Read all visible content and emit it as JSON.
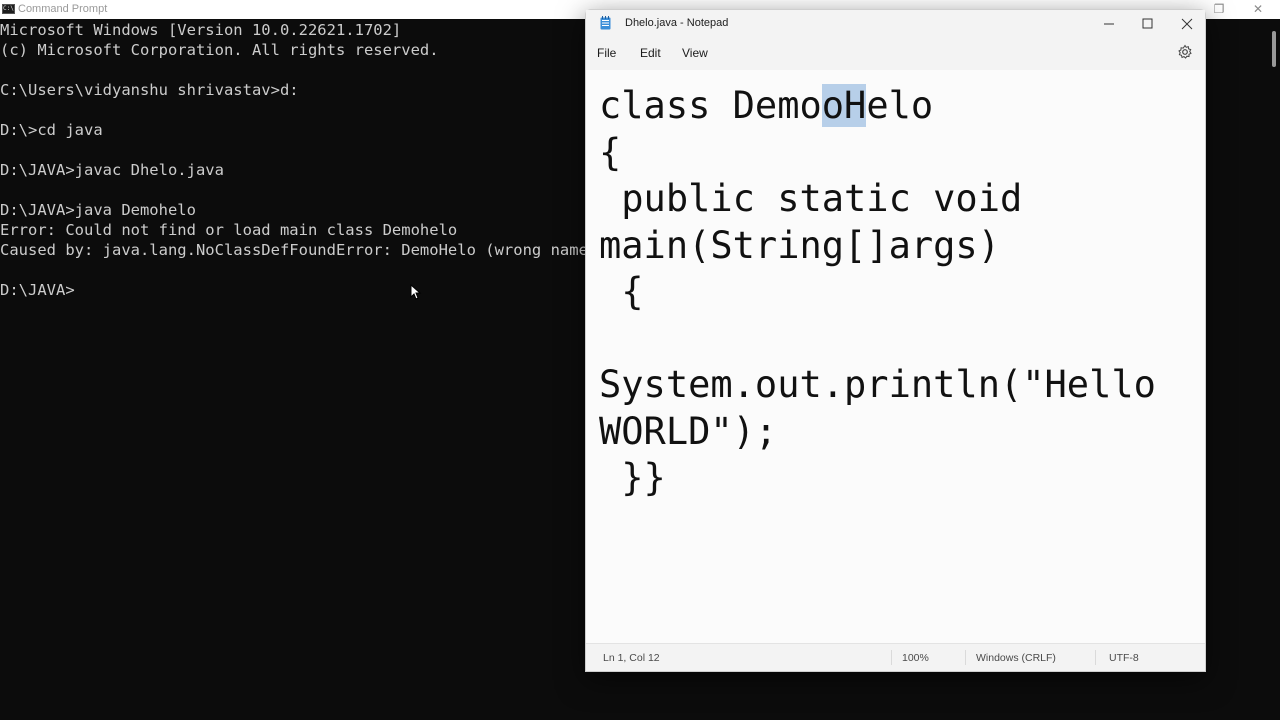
{
  "cmd": {
    "title": "Command Prompt",
    "lines": [
      "Microsoft Windows [Version 10.0.22621.1702]",
      "(c) Microsoft Corporation. All rights reserved.",
      "",
      "C:\\Users\\vidyanshu shrivastav>d:",
      "",
      "D:\\>cd java",
      "",
      "D:\\JAVA>javac Dhelo.java",
      "",
      "D:\\JAVA>java Demohelo",
      "Error: Could not find or load main class Demohelo",
      "Caused by: java.lang.NoClassDefFoundError: DemoHelo (wrong name",
      "",
      "D:\\JAVA>"
    ]
  },
  "notepad": {
    "title": "Dhelo.java - Notepad",
    "menu": {
      "file": "File",
      "edit": "Edit",
      "view": "View"
    },
    "icons": {
      "app": "notepad-icon",
      "minimize": "minimize-icon",
      "maximize": "maximize-icon",
      "close": "close-icon",
      "settings": "gear-icon"
    },
    "editor": {
      "line1_before": "class Demo",
      "line1_selected": "oH",
      "line1_after": "elo",
      "lines": [
        "{",
        " public static void",
        "main(String[]args)",
        " {",
        "",
        "System.out.println(\"Hello",
        "WORLD\");",
        " }}"
      ]
    },
    "status": {
      "position": "Ln 1, Col 12",
      "zoom": "100%",
      "line_ending": "Windows (CRLF)",
      "encoding": "UTF-8"
    }
  },
  "colors": {
    "console_bg": "#0c0c0c",
    "console_text": "#cccccc",
    "selection": "#b7cfe9"
  }
}
